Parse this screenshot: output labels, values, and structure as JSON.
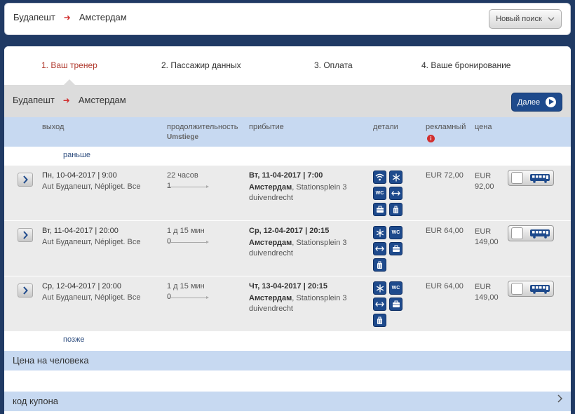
{
  "header": {
    "from": "Будапешт",
    "arrow": "➜",
    "to": "Амстердам",
    "new_search_label": "Новый поиск"
  },
  "steps": [
    {
      "label": "1. Ваш тренер",
      "active": true
    },
    {
      "label": "2. Пассажир данных",
      "active": false
    },
    {
      "label": "3. Оплата",
      "active": false
    },
    {
      "label": "4. Ваше бронирование",
      "active": false
    }
  ],
  "route_bar": {
    "from": "Будапешт",
    "arrow": "➜",
    "to": "Амстердам",
    "next_label": "Далее"
  },
  "columns": {
    "departure": "выход",
    "duration": "продолжительность",
    "transfers": "Umstiege",
    "arrival": "прибытие",
    "details": "детали",
    "promo": "рекламный",
    "promo_info": "i",
    "price": "цена"
  },
  "earlier_label": "раньше",
  "later_label": "позже",
  "rows": [
    {
      "dep_date": "Пн, 10-04-2017 | 9:00",
      "dep_station": "Aut Будапешт, Népliget. Все",
      "duration": "22 часов",
      "transfers": "1",
      "arr_date": "Вт, 11-04-2017 | 7:00",
      "arr_city": "Амстердам",
      "arr_station": ", Stationsplein 3",
      "arr_station2": "duivendrecht",
      "promo_price": "EUR 72,00",
      "price_cur": "EUR",
      "price_val": "92,00",
      "icons": [
        "wifi-icon",
        "snowflake-icon",
        "wc-icon",
        "legroom-icon",
        "luggage-icon",
        "baggage-icon"
      ]
    },
    {
      "dep_date": "Вт, 11-04-2017 | 20:00",
      "dep_station": "Aut Будапешт, Népliget. Все",
      "duration": "1 д 15 мин",
      "transfers": "0",
      "arr_date": "Ср, 12-04-2017 | 20:15",
      "arr_city": "Амстердам",
      "arr_station": ", Stationsplein 3",
      "arr_station2": "duivendrecht",
      "promo_price": "EUR 64,00",
      "price_cur": "EUR",
      "price_val": "149,00",
      "icons": [
        "snowflake-icon",
        "wc-icon",
        "legroom-icon",
        "luggage-icon",
        "baggage-icon"
      ]
    },
    {
      "dep_date": "Ср, 12-04-2017 | 20:00",
      "dep_station": "Aut Будапешт, Népliget. Все",
      "duration": "1 д 15 мин",
      "transfers": "0",
      "arr_date": "Чт, 13-04-2017 | 20:15",
      "arr_city": "Амстердам",
      "arr_station": ", Stationsplein 3",
      "arr_station2": "duivendrecht",
      "promo_price": "EUR 64,00",
      "price_cur": "EUR",
      "price_val": "149,00",
      "icons": [
        "snowflake-icon",
        "wc-icon",
        "legroom-icon",
        "luggage-icon",
        "baggage-icon"
      ]
    }
  ],
  "icon_text": {
    "wc": "WC"
  },
  "price_per_person_label": "Цена на человека",
  "coupon_label": "код купона",
  "colors": {
    "accent_blue": "#1e4a8c",
    "active_step": "#b03a2e",
    "route_arrow": "#d12f2f",
    "header_band": "#c7d9f1"
  }
}
